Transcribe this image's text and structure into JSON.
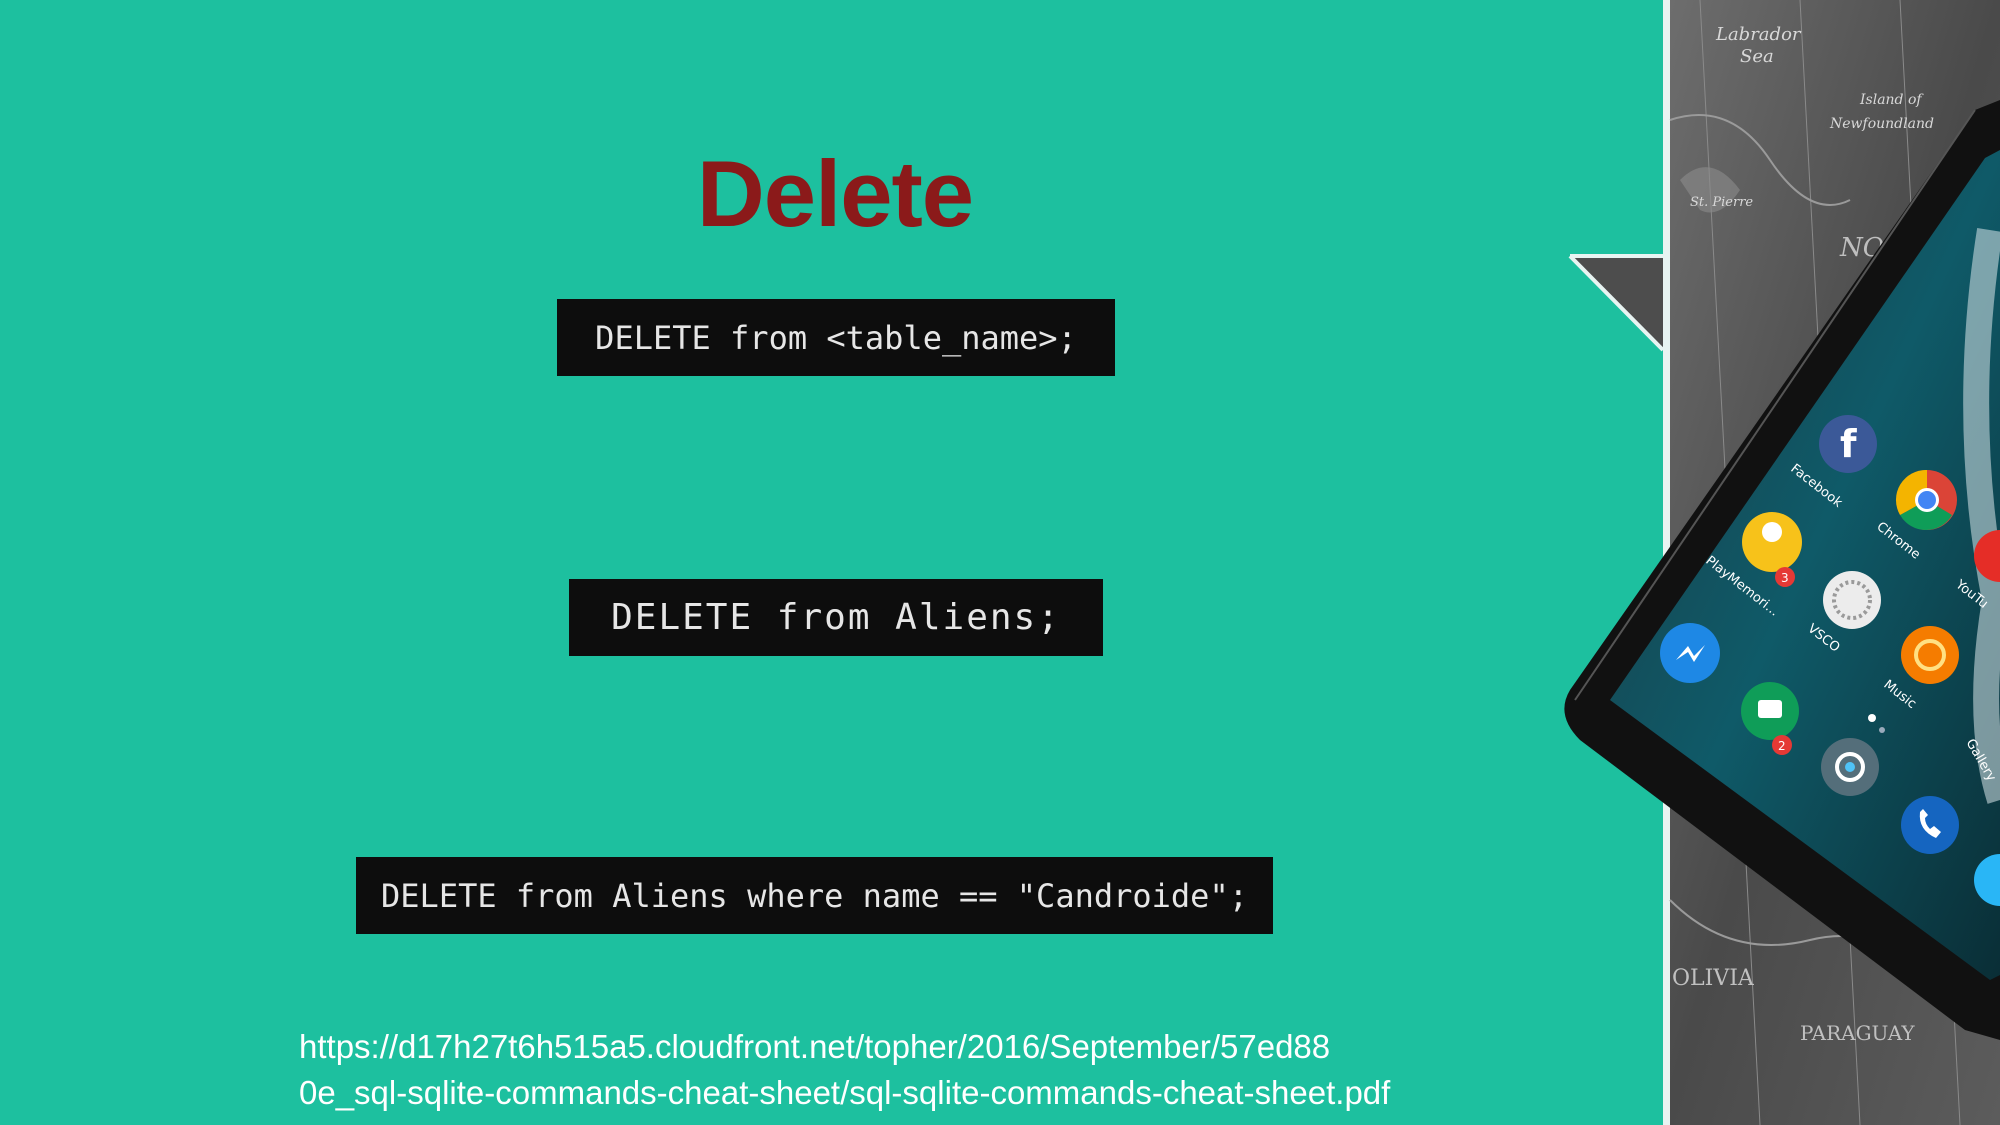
{
  "slide": {
    "title": "Delete",
    "title_color": "#8b1a1a",
    "background_color": "#1dc09f",
    "code_snippets": [
      "DELETE from <table_name>;",
      "DELETE from Aliens;",
      "DELETE from Aliens where name == \"Candroide\";"
    ],
    "code_text_color": "#e6e6e6",
    "code_bg_color": "#0d0d0d",
    "source_url_lines": [
      "https://d17h27t6h515a5.cloudfront.net/topher/2016/September/57ed88",
      "0e_sql-sqlite-commands-cheat-sheet/sql-sqlite-commands-cheat-sheet.pdf"
    ]
  },
  "side_image": {
    "map_labels": [
      "Labrador",
      "Sea",
      "Island of",
      "Newfoundland",
      "St. Pierre",
      "NO",
      "OLIVIA",
      "PARAGUAY"
    ],
    "apps": [
      {
        "icon": "facebook-icon",
        "label": "Facebook"
      },
      {
        "icon": "chrome-icon",
        "label": "Chrome"
      },
      {
        "icon": "youtube-icon",
        "label": "YouTu"
      },
      {
        "icon": "playmemories-icon",
        "label": "PlayMemori...",
        "badge": "3"
      },
      {
        "icon": "vsco-icon",
        "label": "VSCO"
      },
      {
        "icon": "music-icon",
        "label": "Music"
      },
      {
        "icon": "messenger-icon",
        "label": ""
      },
      {
        "icon": "hangouts-icon",
        "label": "",
        "badge": "2"
      },
      {
        "icon": "camera-icon",
        "label": ""
      },
      {
        "icon": "phone-icon",
        "label": ""
      },
      {
        "icon": "gallery-icon",
        "label": "Gallery"
      }
    ]
  }
}
